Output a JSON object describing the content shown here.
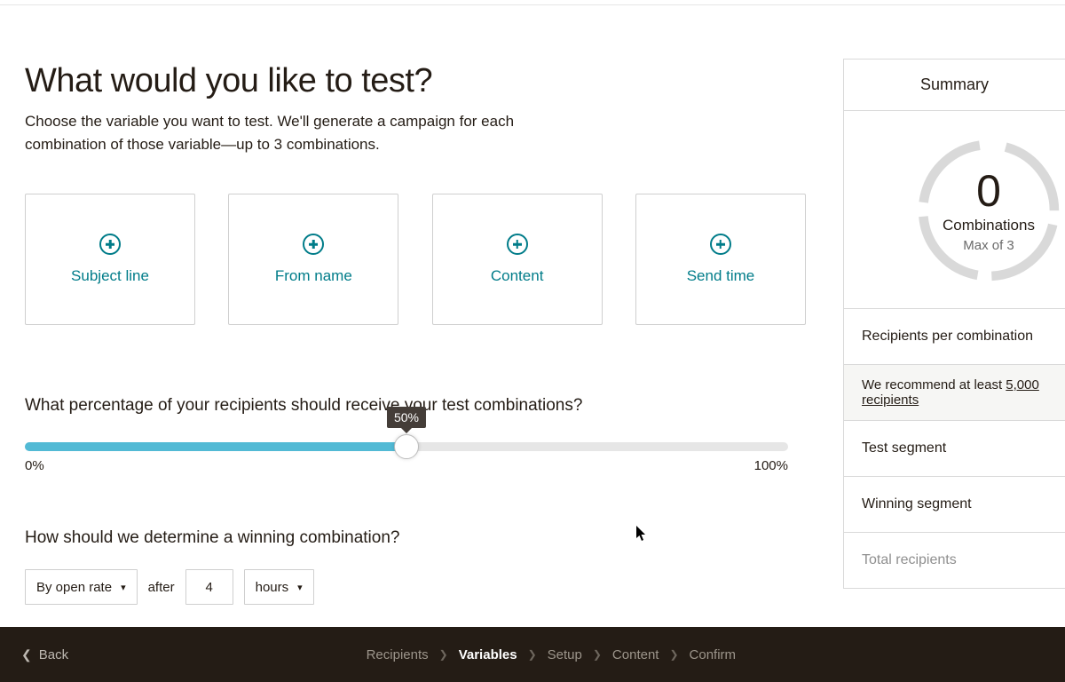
{
  "header": {
    "title": "What would you like to test?",
    "subtitle": "Choose the variable you want to test. We'll generate a campaign for each combination of those variable—up to 3 combinations."
  },
  "cards": [
    {
      "label": "Subject line"
    },
    {
      "label": "From name"
    },
    {
      "label": "Content"
    },
    {
      "label": "Send time"
    }
  ],
  "slider": {
    "question": "What percentage of your recipients should receive your test combinations?",
    "tooltip": "50%",
    "min_label": "0%",
    "max_label": "100%"
  },
  "winning": {
    "question": "How should we determine a winning combination?",
    "metric": "By open rate",
    "after": "after",
    "hours_value": "4",
    "hours_unit": "hours"
  },
  "sidebar": {
    "title": "Summary",
    "gauge_number": "0",
    "gauge_label": "Combinations",
    "gauge_sub": "Max of 3",
    "rows": {
      "recipients_per": "Recipients per combination",
      "recommend_prefix": "We recommend at least ",
      "recommend_link": "5,000 recipients",
      "test_segment": "Test segment",
      "winning_segment": "Winning segment",
      "total": "Total recipients"
    }
  },
  "bottombar": {
    "back": "Back",
    "steps": [
      "Recipients",
      "Variables",
      "Setup",
      "Content",
      "Confirm"
    ],
    "active_index": 1
  }
}
